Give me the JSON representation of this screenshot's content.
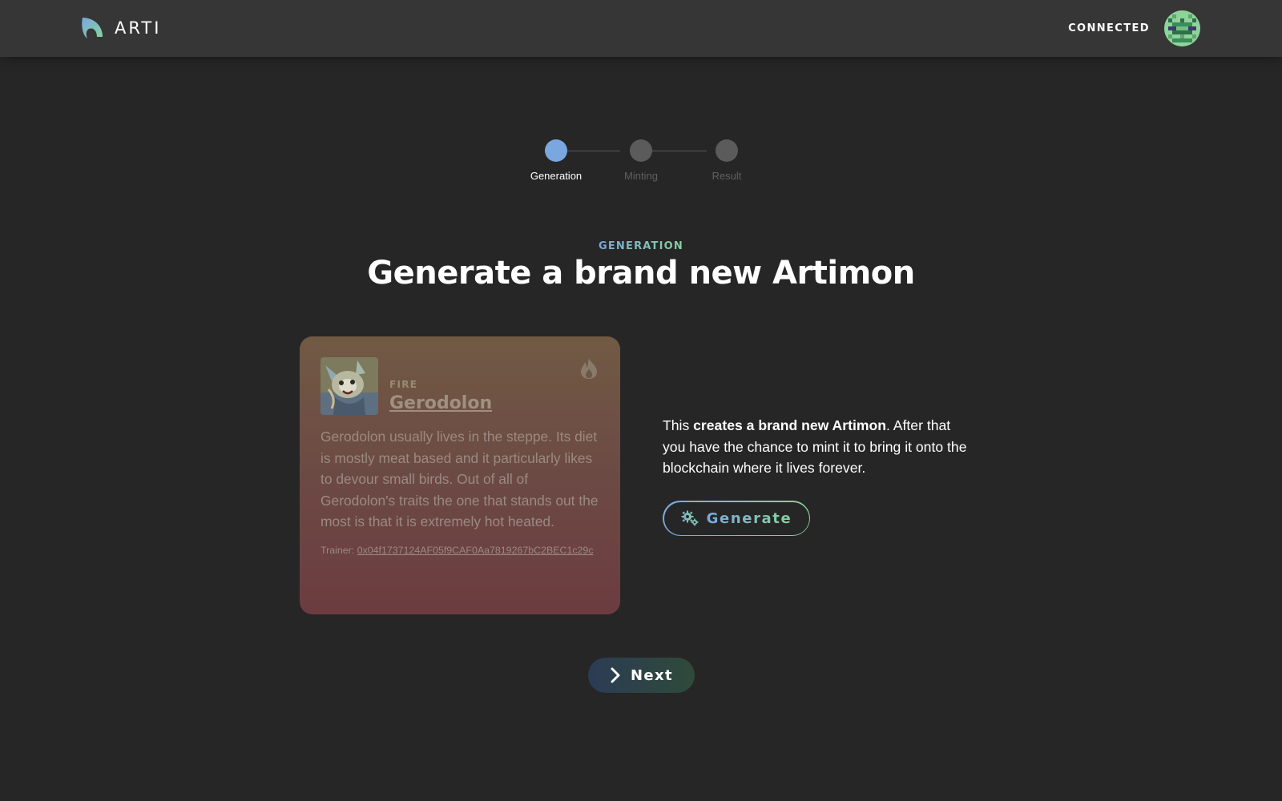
{
  "header": {
    "app_name": "ARTI",
    "connection_status": "CONNECTED"
  },
  "stepper": {
    "active_index": 0,
    "steps": [
      {
        "label": "Generation"
      },
      {
        "label": "Minting"
      },
      {
        "label": "Result"
      }
    ]
  },
  "section": {
    "eyebrow": "GENERATION",
    "title": "Generate a brand new Artimon"
  },
  "card": {
    "type": "FIRE",
    "type_icon": "flame-icon",
    "name": "Gerodolon",
    "description": "Gerodolon usually lives in the steppe. Its diet is mostly meat based and it particularly likes to devour small birds. Out of all of Gerodolon's traits the one that stands out the most is that it is extremely hot heated.",
    "trainer_label": "Trainer: ",
    "trainer_address": "0x04f1737124AF05f9CAF0Aa7819267bC2BEC1c29c"
  },
  "info": {
    "text_before": "This ",
    "text_bold": "creates a brand new Artimon",
    "text_after": ". After that you have the chance to mint it to bring it onto the blockchain where it lives forever."
  },
  "buttons": {
    "generate_label": "Generate",
    "generate_icon": "gears-icon",
    "next_label": "Next",
    "next_icon": "chevron-right-icon"
  },
  "colors": {
    "background": "#262626",
    "header": "#363636",
    "accent_blue": "#7aa7df",
    "accent_green": "#86d49a",
    "step_inactive": "#5b5b5b"
  }
}
